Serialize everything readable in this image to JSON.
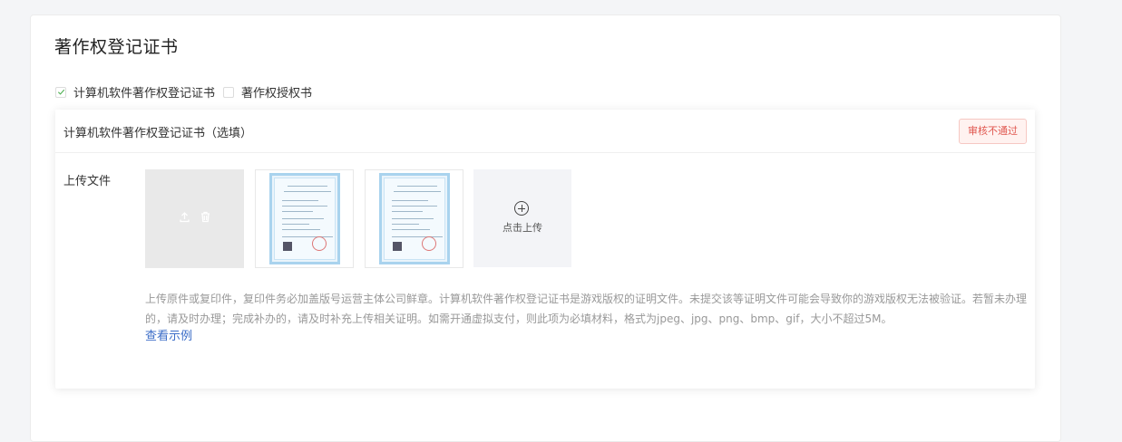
{
  "section": {
    "title": "著作权登记证书"
  },
  "checkboxes": [
    {
      "label": "计算机软件著作权登记证书",
      "checked": true
    },
    {
      "label": "著作权授权书",
      "checked": false
    }
  ],
  "card": {
    "title": "计算机软件著作权登记证书（选填）",
    "status": "审核不通过",
    "status_color": "#e0574f",
    "upload_label": "上传文件",
    "uploaded_files": [
      {
        "type": "disabled",
        "icons": [
          "upload-icon",
          "trash-icon"
        ]
      },
      {
        "type": "certificate-image"
      },
      {
        "type": "certificate-image"
      }
    ],
    "add_label": "点击上传",
    "help_text": "上传原件或复印件，复印件务必加盖版号运营主体公司鲜章。计算机软件著作权登记证书是游戏版权的证明文件。未提交该等证明文件可能会导致你的游戏版权无法被验证。若暂未办理的，请及时办理；完成补办的，请及时补充上传相关证明。如需开通虚拟支付，则此项为必填材料，格式为jpeg、jpg、png、bmp、gif，大小不超过5M。",
    "example_link": "查看示例"
  }
}
